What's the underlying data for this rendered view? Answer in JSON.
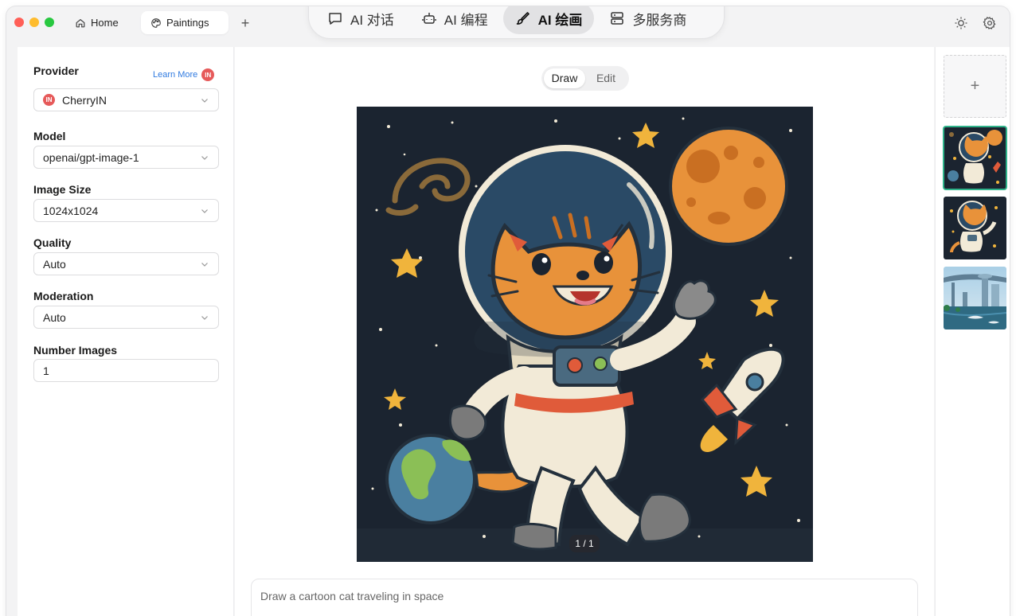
{
  "tabs": [
    {
      "label": "Home",
      "icon": "home-icon"
    },
    {
      "label": "Paintings",
      "icon": "palette-icon",
      "active": true
    }
  ],
  "topnav": [
    {
      "label": "AI 对话",
      "icon": "chat-bubble-icon"
    },
    {
      "label": "AI 编程",
      "icon": "robot-icon"
    },
    {
      "label": "AI 绘画",
      "icon": "brush-icon",
      "active": true
    },
    {
      "label": "多服务商",
      "icon": "server-icon"
    }
  ],
  "sidebar": {
    "provider_label": "Provider",
    "learn_more": "Learn More",
    "provider_badge": "IN",
    "provider_value": "CherryIN",
    "model_label": "Model",
    "model_value": "openai/gpt-image-1",
    "size_label": "Image Size",
    "size_value": "1024x1024",
    "quality_label": "Quality",
    "quality_value": "Auto",
    "moderation_label": "Moderation",
    "moderation_value": "Auto",
    "number_label": "Number Images",
    "number_value": "1"
  },
  "main": {
    "mode_draw": "Draw",
    "mode_edit": "Edit",
    "counter": "1 / 1",
    "prompt": "Draw a cartoon cat traveling in space"
  },
  "gallery": {
    "add": "+",
    "thumbs": [
      "cat-astronaut-thumb",
      "cat-astronaut-thumb-2",
      "futuristic-city-thumb"
    ]
  },
  "colors": {
    "accent_selected": "#2fb38a",
    "space_bg": "#1b2430",
    "cat_orange": "#e8923a",
    "badge_red": "#e65a5a",
    "link_blue": "#2f7ae0"
  }
}
